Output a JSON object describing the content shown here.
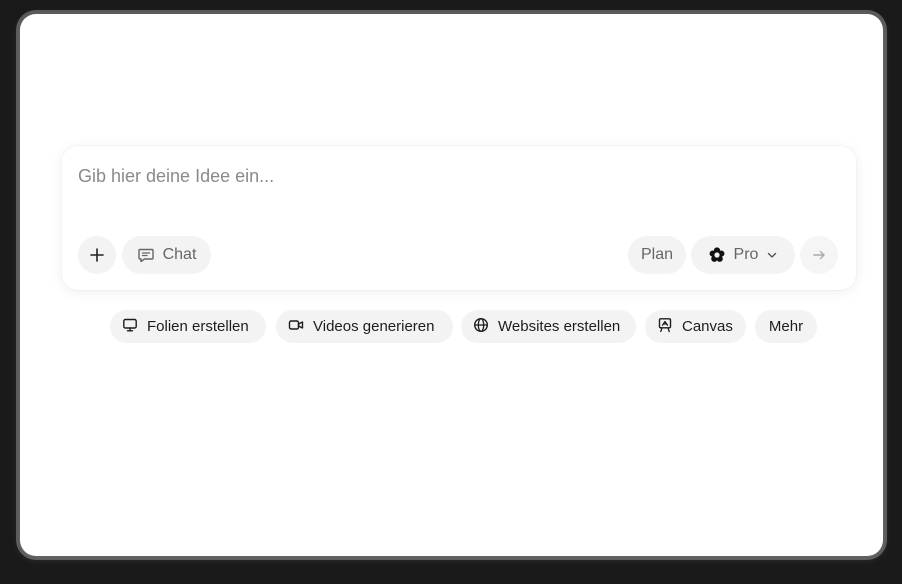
{
  "composer": {
    "placeholder": "Gib hier deine Idee ein...",
    "chat_label": "Chat",
    "plan_label": "Plan",
    "model_label": "Pro"
  },
  "suggestions": {
    "folien": "Folien erstellen",
    "videos": "Videos generieren",
    "websites": "Websites erstellen",
    "canvas": "Canvas",
    "mehr": "Mehr"
  },
  "icons": {
    "add": "plus-icon",
    "chat": "chat-bubble-icon",
    "model": "flower-logo-icon",
    "dropdown": "chevron-down-icon",
    "send": "arrow-right-icon",
    "folien": "presentation-icon",
    "videos": "video-camera-icon",
    "websites": "globe-icon",
    "canvas": "canvas-easel-icon"
  }
}
